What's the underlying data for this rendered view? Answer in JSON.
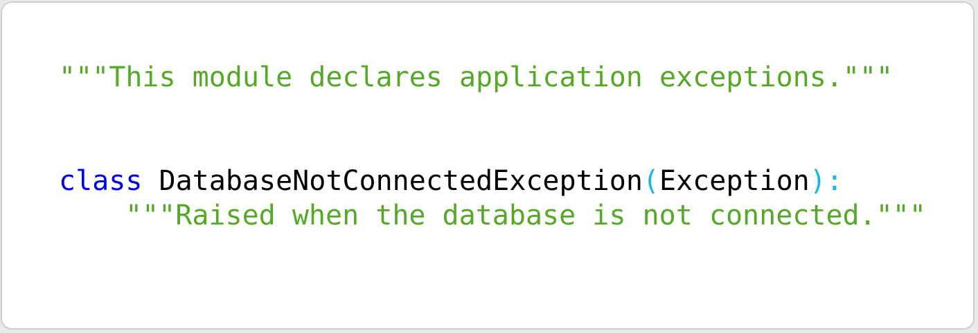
{
  "code": {
    "line1_docstring": "\"\"\"This module declares application exceptions.\"\"\"",
    "keyword_class": "class",
    "class_name": "DatabaseNotConnectedException",
    "paren_open": "(",
    "base_class": "Exception",
    "paren_close_colon": "):",
    "class_docstring": "\"\"\"Raised when the database is not connected.\"\"\""
  },
  "colors": {
    "keyword": "#0000e0",
    "string": "#56a828",
    "punctuation": "#1ab5e8",
    "identifier": "#000000",
    "background": "#ffffff",
    "border": "#cfcfcf"
  }
}
